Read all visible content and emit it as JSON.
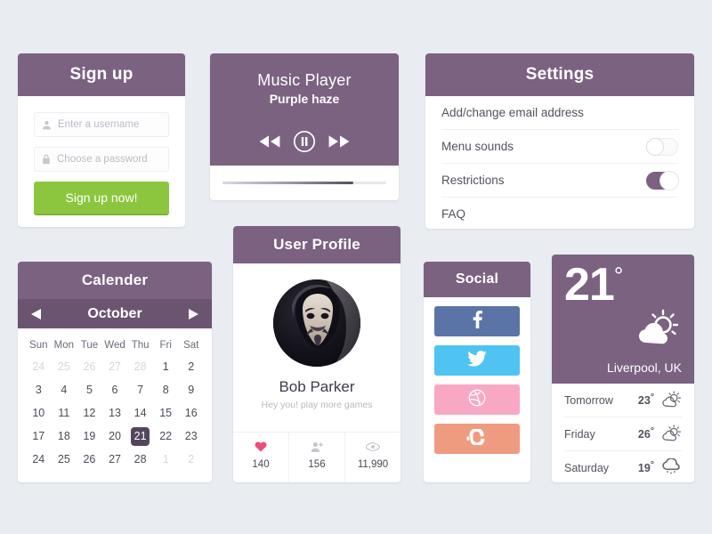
{
  "theme": {
    "background": "#e9edf2",
    "purple": "#7b6281",
    "purple_dark": "#6b5470",
    "green": "#8cc63f",
    "card_white": "#ffffff"
  },
  "signup": {
    "title": "Sign up",
    "username_placeholder": "Enter a username",
    "username_value": "",
    "password_placeholder": "Choose a password",
    "password_value": "",
    "username_icon": "person-icon",
    "password_icon": "lock-icon",
    "button_label": "Sign up now!"
  },
  "music": {
    "title": "Music Player",
    "subtitle": "Purple haze",
    "rewind_icon": "rewind-icon",
    "pause_icon": "pause-icon",
    "forward_icon": "fast-forward-icon",
    "progress_percent": 80
  },
  "settings": {
    "title": "Settings",
    "rows": [
      {
        "label": "Add/change email address",
        "control": "none"
      },
      {
        "label": "Menu sounds",
        "control": "toggle",
        "state": "off"
      },
      {
        "label": "Restrictions",
        "control": "toggle",
        "state": "on"
      },
      {
        "label": "FAQ",
        "control": "none"
      }
    ]
  },
  "calendar": {
    "title": "Calender",
    "month": "October",
    "prev_icon": "caret-left-icon",
    "next_icon": "caret-right-icon",
    "weekdays": [
      "Sun",
      "Mon",
      "Tue",
      "Wed",
      "Thu",
      "Fri",
      "Sat"
    ],
    "weeks": [
      [
        {
          "d": "24",
          "muted": true
        },
        {
          "d": "25",
          "muted": true
        },
        {
          "d": "26",
          "muted": true
        },
        {
          "d": "27",
          "muted": true
        },
        {
          "d": "28",
          "muted": true
        },
        {
          "d": "1"
        },
        {
          "d": "2"
        }
      ],
      [
        {
          "d": "3"
        },
        {
          "d": "4"
        },
        {
          "d": "5"
        },
        {
          "d": "6"
        },
        {
          "d": "7"
        },
        {
          "d": "8"
        },
        {
          "d": "9"
        }
      ],
      [
        {
          "d": "10"
        },
        {
          "d": "11"
        },
        {
          "d": "12"
        },
        {
          "d": "13"
        },
        {
          "d": "14"
        },
        {
          "d": "15"
        },
        {
          "d": "16"
        }
      ],
      [
        {
          "d": "17"
        },
        {
          "d": "18"
        },
        {
          "d": "19"
        },
        {
          "d": "20"
        },
        {
          "d": "21",
          "today": true
        },
        {
          "d": "22"
        },
        {
          "d": "23"
        }
      ],
      [
        {
          "d": "24"
        },
        {
          "d": "25"
        },
        {
          "d": "26"
        },
        {
          "d": "27"
        },
        {
          "d": "28"
        },
        {
          "d": "1",
          "muted": true
        },
        {
          "d": "2",
          "muted": true
        }
      ]
    ]
  },
  "profile": {
    "title": "User Profile",
    "avatar": "guy-fawkes-mask-avatar",
    "name": "Bob Parker",
    "tagline": "Hey you! play more games",
    "stats": [
      {
        "icon": "heart-icon",
        "color": "#ee4d7c",
        "value": "140"
      },
      {
        "icon": "add-person-icon",
        "color": "#c3c5cc",
        "value": "156"
      },
      {
        "icon": "eye-icon",
        "color": "#c3c5cc",
        "value": "11,990"
      }
    ]
  },
  "social": {
    "title": "Social",
    "buttons": [
      {
        "network": "facebook",
        "icon": "facebook-icon",
        "color": "#5b74a8"
      },
      {
        "network": "twitter",
        "icon": "twitter-icon",
        "color": "#4fc3f1"
      },
      {
        "network": "dribbble",
        "icon": "dribbble-icon",
        "color": "#f9a8c4"
      },
      {
        "network": "stumbleupon",
        "icon": "stumbleupon-icon",
        "color": "#ef9b7f"
      }
    ]
  },
  "weather": {
    "current_temp": "21",
    "degree": "°",
    "city": "Liverpool, UK",
    "current_icon": "sun-behind-cloud-icon",
    "forecast": [
      {
        "day": "Tomorrow",
        "temp": "23",
        "degree": "°",
        "icon": "sun-behind-cloud-icon"
      },
      {
        "day": "Friday",
        "temp": "26",
        "degree": "°",
        "icon": "sun-behind-cloud-icon"
      },
      {
        "day": "Saturday",
        "temp": "19",
        "degree": "°",
        "icon": "rain-cloud-icon"
      }
    ]
  }
}
